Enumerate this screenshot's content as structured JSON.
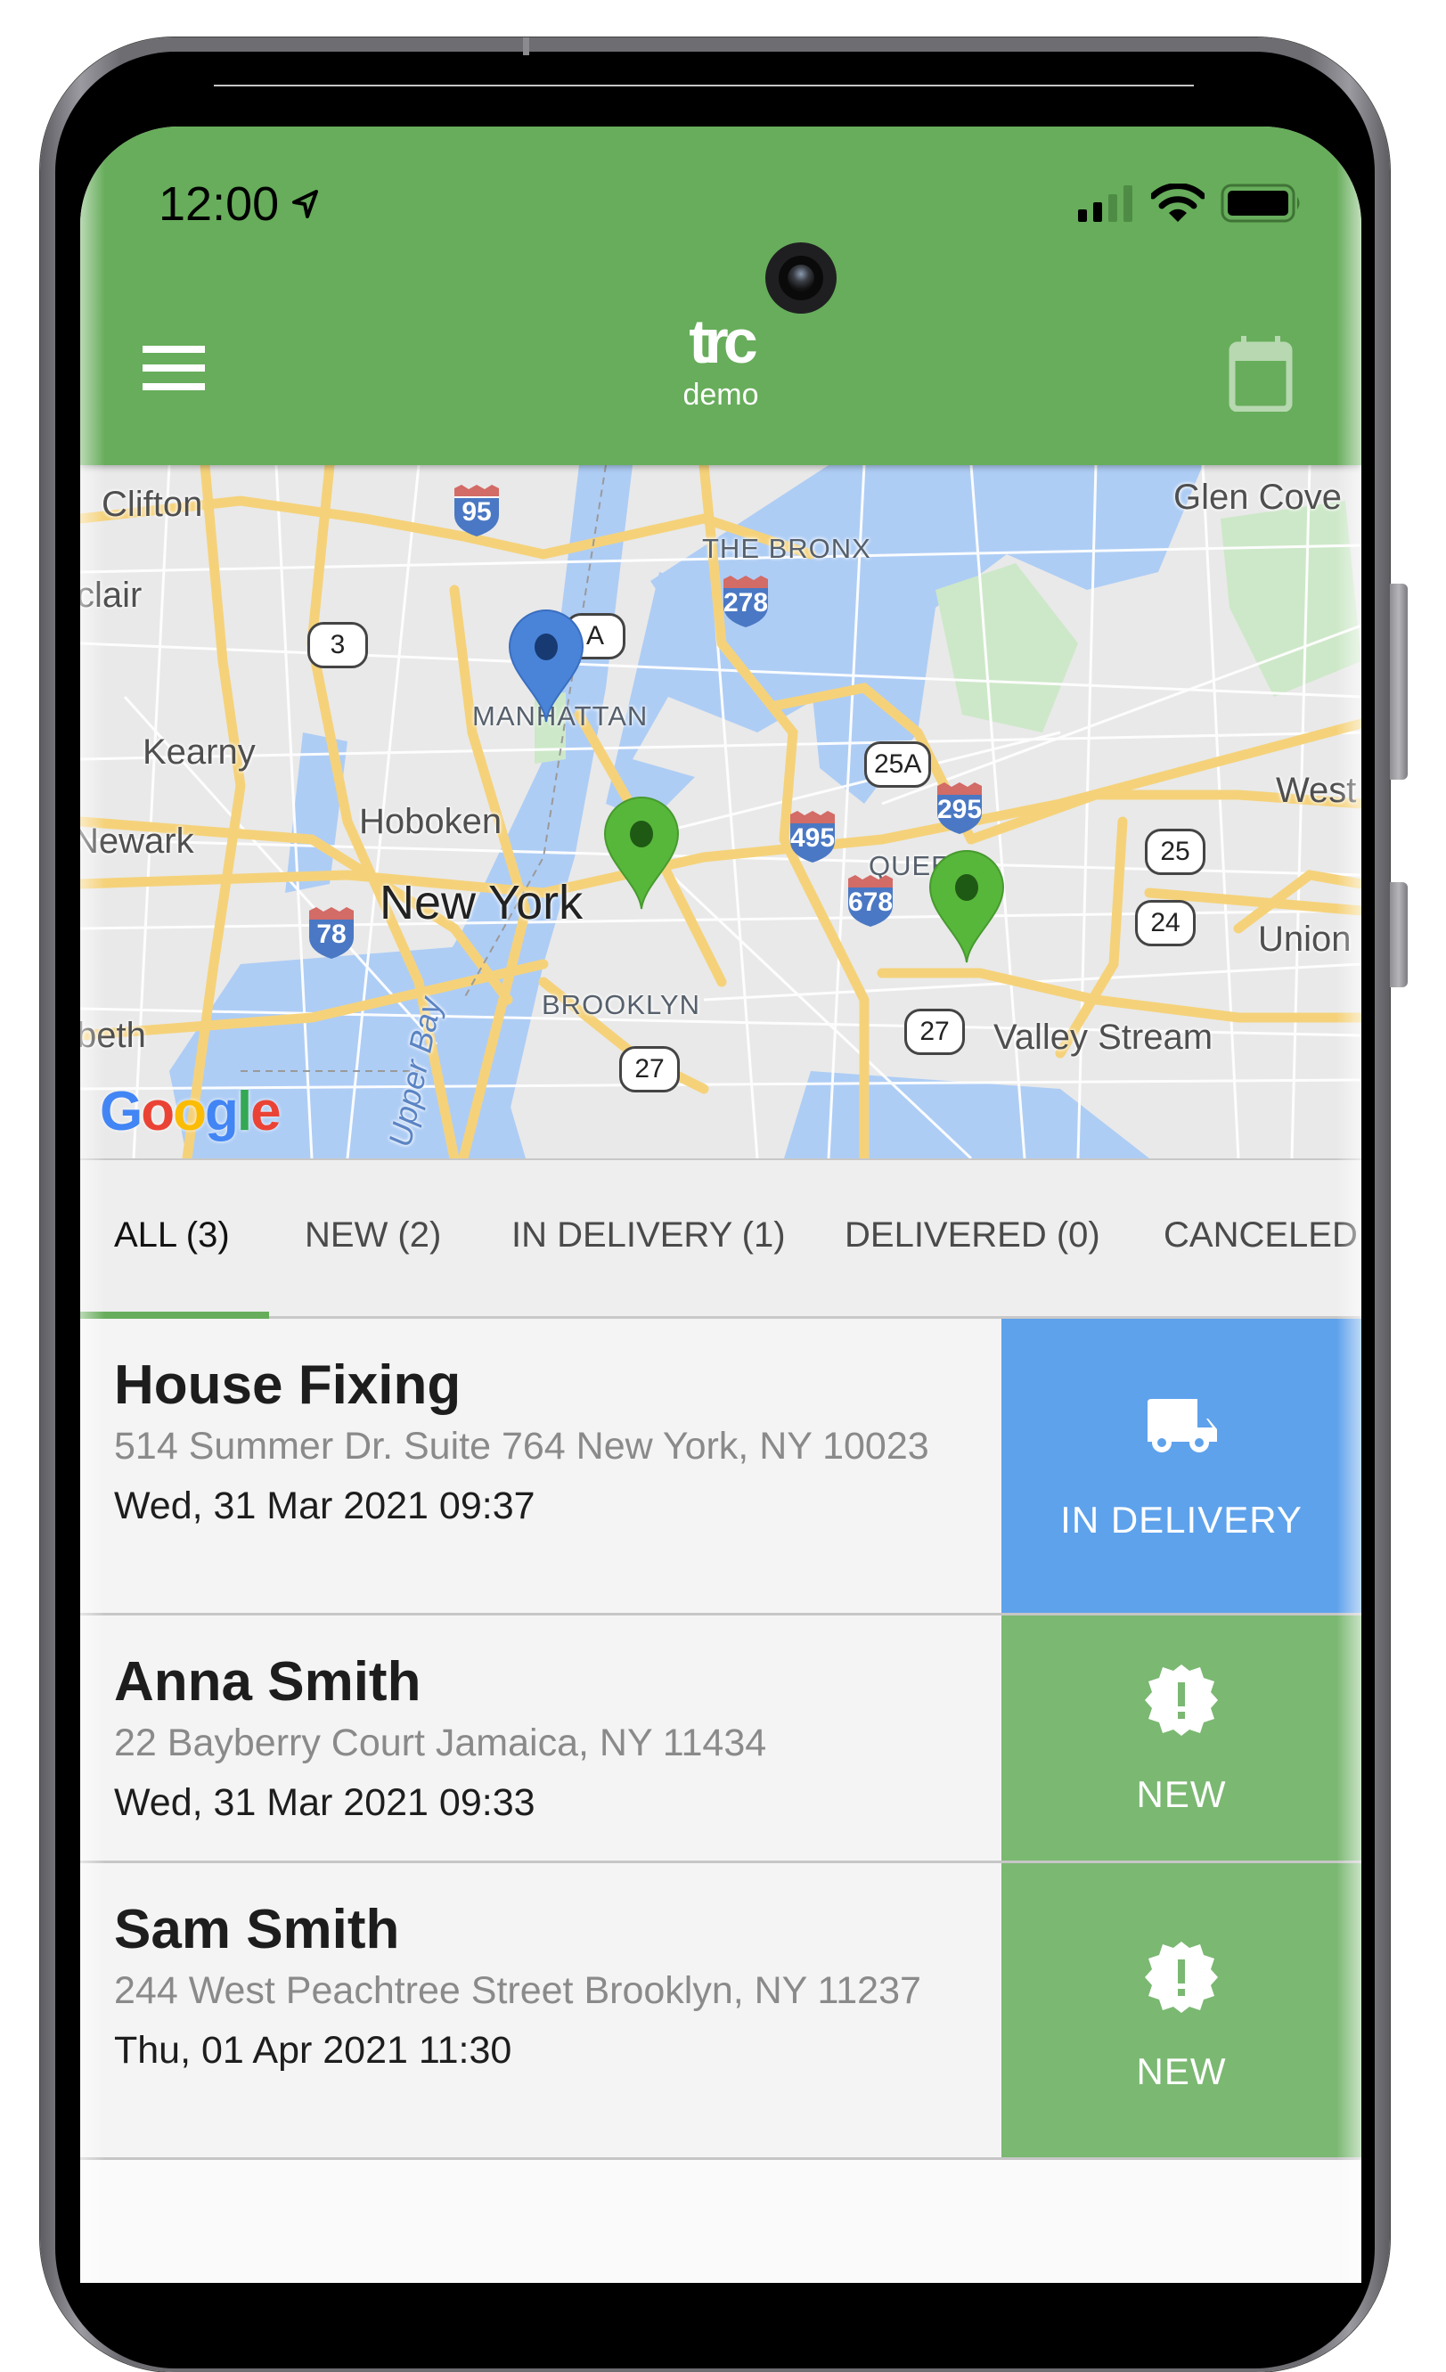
{
  "status_bar": {
    "time": "12:00",
    "location_icon": "location-arrow-icon",
    "signal_icon": "cellular-signal-icon",
    "wifi_icon": "wifi-icon",
    "battery_icon": "battery-icon"
  },
  "header": {
    "menu_icon": "hamburger-menu-icon",
    "logo": "trc",
    "subtitle": "demo",
    "calendar_icon": "calendar-icon",
    "color": "#67ad5b"
  },
  "map": {
    "provider": "Google",
    "labels": {
      "clifton": "Clifton",
      "clair": "clair",
      "kearny": "Kearny",
      "newark": "Newark",
      "hoboken": "Hoboken",
      "new_york": "New York",
      "beth": "beth",
      "manhattan": "MANHATTAN",
      "bronx": "THE BRONX",
      "queens": "QUEENS",
      "brooklyn": "BROOKLYN",
      "glen_cove": "Glen Cove",
      "west": "West",
      "union": "Union",
      "valley_stream": "Valley Stream",
      "upper_bay": "Upper Bay"
    },
    "shields": {
      "i95": "95",
      "i278": "278",
      "i495": "495",
      "i295": "295",
      "i678": "678",
      "i78": "78",
      "s3": "3",
      "s25a": "25A",
      "s25": "25",
      "s24": "24",
      "s27a": "27",
      "s27b": "27",
      "s9a": "A"
    },
    "markers": [
      {
        "status": "in_delivery",
        "color": "#4a84d8"
      },
      {
        "status": "new",
        "color": "#57b73a"
      },
      {
        "status": "new",
        "color": "#57b73a"
      }
    ]
  },
  "tabs": [
    {
      "label": "ALL (3)",
      "active": true
    },
    {
      "label": "NEW (2)",
      "active": false
    },
    {
      "label": "IN DELIVERY (1)",
      "active": false
    },
    {
      "label": "DELIVERED (0)",
      "active": false
    },
    {
      "label": "CANCELED",
      "active": false
    }
  ],
  "orders": [
    {
      "title": "House Fixing",
      "address": "514 Summer Dr. Suite 764 New York, NY 10023",
      "date": "Wed, 31 Mar 2021 09:37",
      "status": "IN DELIVERY",
      "status_icon": "truck-icon",
      "status_color": "#5ea2ec"
    },
    {
      "title": "Anna Smith",
      "address": "22 Bayberry Court Jamaica, NY 11434",
      "date": "Wed, 31 Mar 2021 09:33",
      "status": "NEW",
      "status_icon": "new-badge-icon",
      "status_color": "#7bb872"
    },
    {
      "title": "Sam Smith",
      "address": "244 West Peachtree Street Brooklyn, NY 11237",
      "date": "Thu, 01 Apr 2021 11:30",
      "status": "NEW",
      "status_icon": "new-badge-icon",
      "status_color": "#7bb872"
    }
  ]
}
